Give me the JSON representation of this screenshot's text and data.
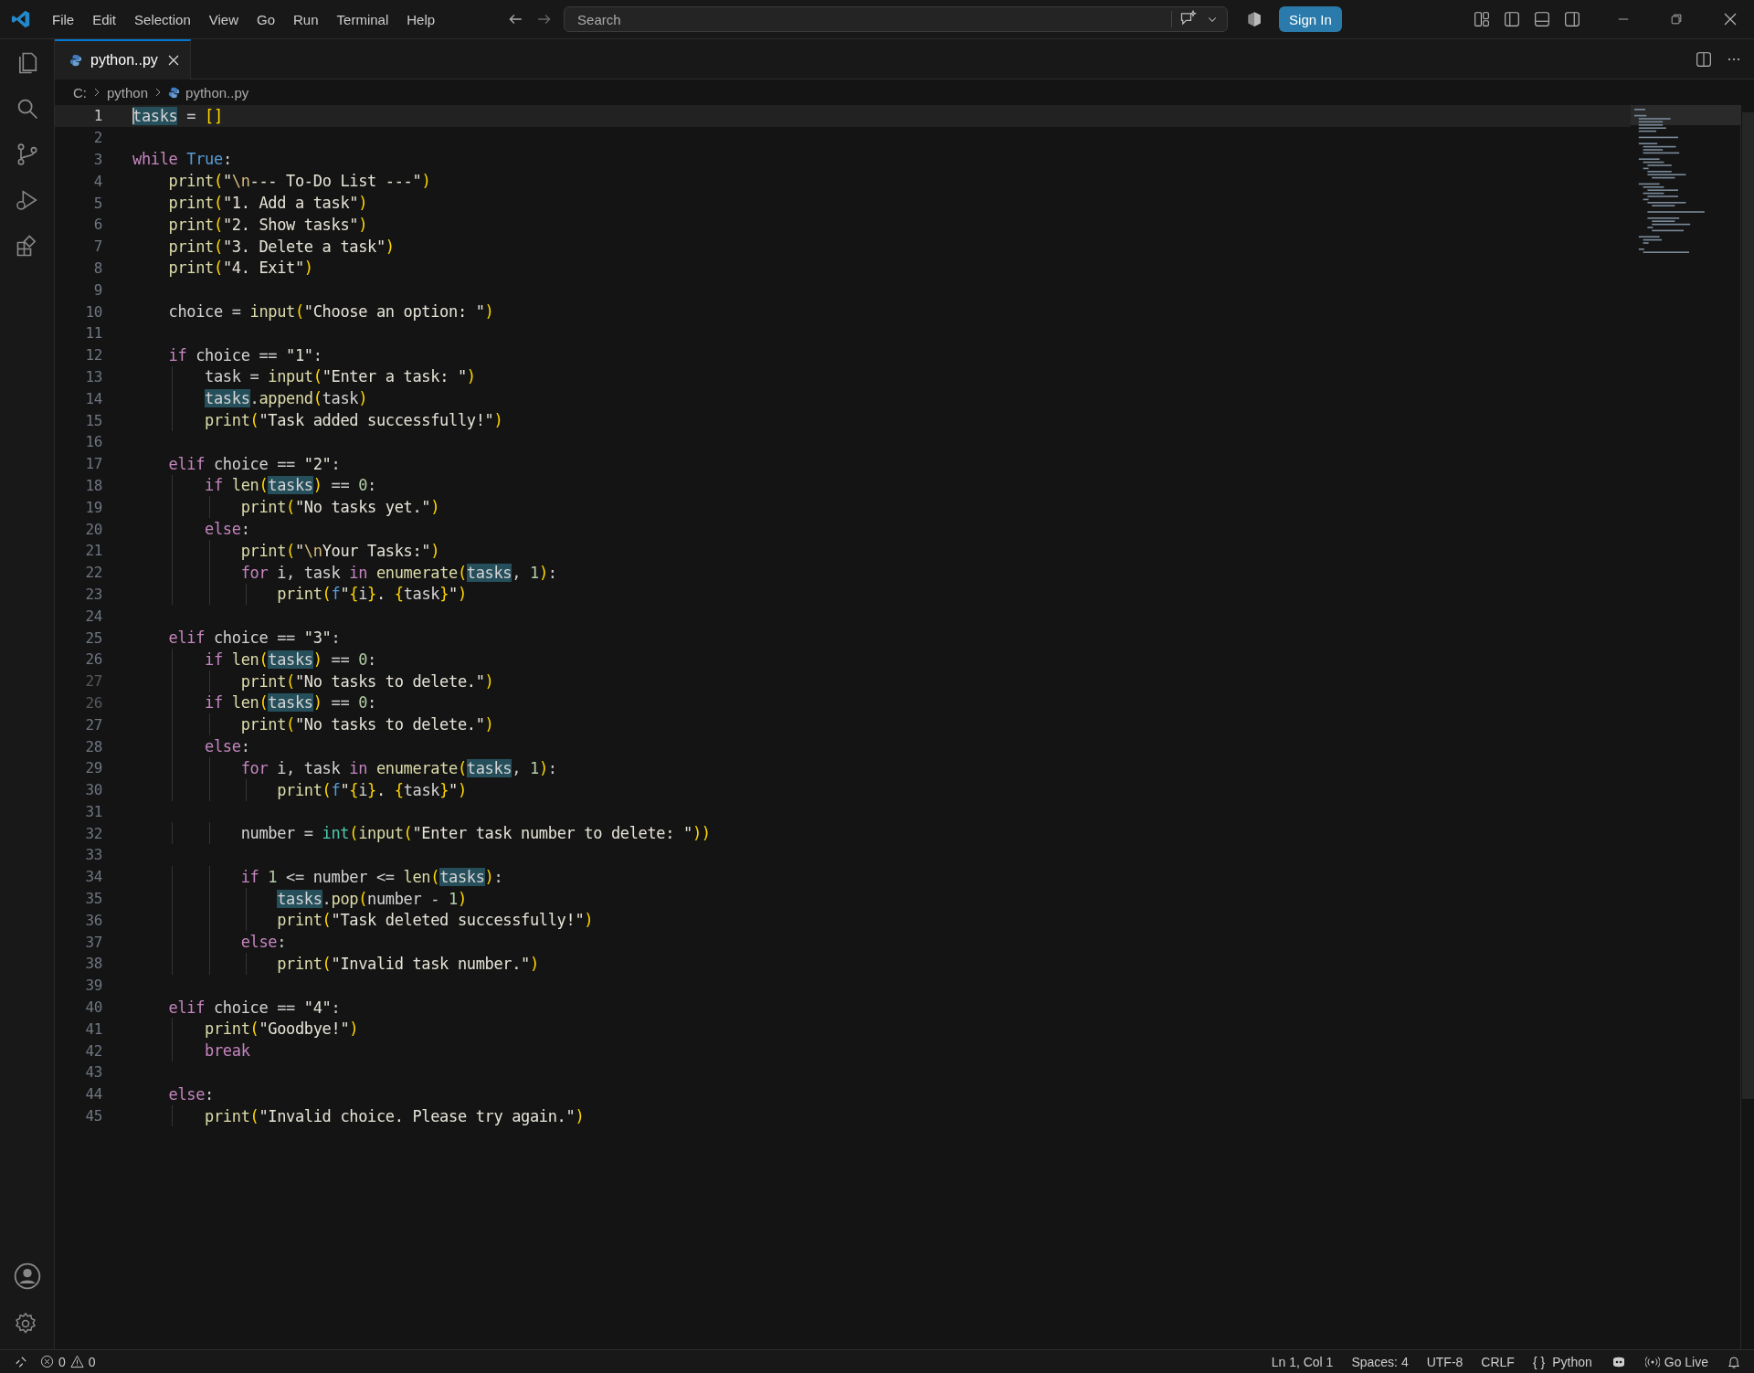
{
  "menu": [
    "File",
    "Edit",
    "Selection",
    "View",
    "Go",
    "Run",
    "Terminal",
    "Help"
  ],
  "search": {
    "placeholder": "Search"
  },
  "sign_in": "Sign In",
  "tabs": [
    {
      "label": "python..py",
      "selected": true
    }
  ],
  "breadcrumb": [
    "C:",
    "python",
    "python..py"
  ],
  "editor": {
    "lines": [
      {
        "number": "1",
        "code": "tasks = []",
        "current": true,
        "ghost": false
      },
      {
        "number": "2",
        "current": false,
        "ghost": false
      },
      {
        "number": "3",
        "code": "while True:",
        "current": false,
        "ghost": false
      },
      {
        "number": "4",
        "code": "    print(\"\\n--- To-Do List ---\")",
        "current": false,
        "ghost": false
      },
      {
        "number": "5",
        "code": "    print(\"1. Add a task\")",
        "current": false,
        "ghost": false
      },
      {
        "number": "6",
        "code": "    print(\"2. Show tasks\")",
        "current": false,
        "ghost": false
      },
      {
        "number": "7",
        "code": "    print(\"3. Delete a task\")",
        "current": false,
        "ghost": false
      },
      {
        "number": "8",
        "code": "    print(\"4. Exit\")",
        "current": false,
        "ghost": false
      },
      {
        "number": "9",
        "current": false,
        "ghost": false
      },
      {
        "number": "10",
        "code": "    choice = input(\"Choose an option: \")",
        "current": false,
        "ghost": false
      },
      {
        "number": "11",
        "current": false,
        "ghost": false
      },
      {
        "number": "12",
        "code": "    if choice == \"1\":",
        "current": false,
        "ghost": false
      },
      {
        "number": "13",
        "code": "        task = input(\"Enter a task: \")",
        "current": false,
        "ghost": false
      },
      {
        "number": "14",
        "code": "        tasks.append(task)",
        "current": false,
        "ghost": false
      },
      {
        "number": "15",
        "code": "        print(\"Task added successfully!\")",
        "current": false,
        "ghost": false
      },
      {
        "number": "16",
        "current": false,
        "ghost": false
      },
      {
        "number": "17",
        "code": "    elif choice == \"2\":",
        "current": false,
        "ghost": false
      },
      {
        "number": "18",
        "code": "        if len(tasks) == 0:",
        "current": false,
        "ghost": false
      },
      {
        "number": "19",
        "code": "            print(\"No tasks yet.\")",
        "current": false,
        "ghost": false
      },
      {
        "number": "20",
        "code": "        else:",
        "current": false,
        "ghost": false
      },
      {
        "number": "21",
        "code": "            print(\"\\nYour Tasks:\")",
        "current": false,
        "ghost": false
      },
      {
        "number": "22",
        "code": "            for i, task in enumerate(tasks, 1):",
        "current": false,
        "ghost": false
      },
      {
        "number": "23",
        "code": "                print(f\"{i}. {task}\")",
        "current": false,
        "ghost": false
      },
      {
        "number": "24",
        "current": false,
        "ghost": false
      },
      {
        "number": "25",
        "code": "    elif choice == \"3\":",
        "current": false,
        "ghost": false
      },
      {
        "number": "26",
        "code": "        if len(tasks) == 0:",
        "current": false,
        "ghost": false
      },
      {
        "number": "27",
        "code": "            print(\"No tasks to delete.\")",
        "current": false,
        "ghost": true
      },
      {
        "number": "26",
        "code": "        if len(tasks) == 0:",
        "current": false,
        "ghost": true
      },
      {
        "number": "27",
        "code": "            print(\"No tasks to delete.\")",
        "current": false,
        "ghost": false
      },
      {
        "number": "28",
        "code": "        else:",
        "current": false,
        "ghost": false
      },
      {
        "number": "29",
        "code": "            for i, task in enumerate(tasks, 1):",
        "current": false,
        "ghost": false
      },
      {
        "number": "30",
        "code": "                print(f\"{i}. {task}\")",
        "current": false,
        "ghost": false
      },
      {
        "number": "31",
        "current": false,
        "ghost": false
      },
      {
        "number": "32",
        "code": "            number = int(input(\"Enter task number to delete: \"))",
        "current": false,
        "ghost": false
      },
      {
        "number": "33",
        "current": false,
        "ghost": false
      },
      {
        "number": "34",
        "code": "            if 1 <= number <= len(tasks):",
        "current": false,
        "ghost": false
      },
      {
        "number": "35",
        "code": "                tasks.pop(number - 1)",
        "current": false,
        "ghost": false
      },
      {
        "number": "36",
        "code": "                print(\"Task deleted successfully!\")",
        "current": false,
        "ghost": false
      },
      {
        "number": "37",
        "code": "            else:",
        "current": false,
        "ghost": false
      },
      {
        "number": "38",
        "code": "                print(\"Invalid task number.\")",
        "current": false,
        "ghost": false
      },
      {
        "number": "39",
        "current": false,
        "ghost": false
      },
      {
        "number": "40",
        "code": "    elif choice == \"4\":",
        "current": false,
        "ghost": false
      },
      {
        "number": "41",
        "code": "        print(\"Goodbye!\")",
        "current": false,
        "ghost": false
      },
      {
        "number": "42",
        "code": "        break",
        "current": false,
        "ghost": false
      },
      {
        "number": "43",
        "current": false,
        "ghost": false
      },
      {
        "number": "44",
        "code": "    else:",
        "current": false,
        "ghost": false
      },
      {
        "number": "45",
        "code": "        print(\"Invalid choice. Please try again.\")",
        "current": false,
        "ghost": false
      }
    ]
  },
  "status_bar": {
    "errors": "0",
    "warnings": "0",
    "items": [
      "Ln 1, Col 1",
      "Spaces: 4",
      "UTF-8",
      "CRLF",
      "{ }",
      "Python",
      "Go Live"
    ]
  }
}
